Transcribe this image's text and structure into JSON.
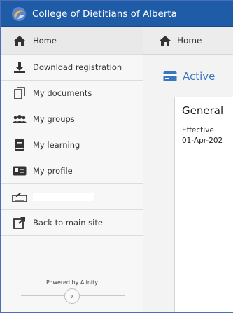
{
  "app": {
    "title": "College of Dietitians of Alberta",
    "brand_color": "#1f5ca8",
    "accent_color": "#3a77c2"
  },
  "sidebar": {
    "items": [
      {
        "label": "Home",
        "icon": "home-icon"
      },
      {
        "label": "Download registration",
        "icon": "download-icon"
      },
      {
        "label": "My documents",
        "icon": "documents-icon"
      },
      {
        "label": "My groups",
        "icon": "groups-icon"
      },
      {
        "label": "My learning",
        "icon": "book-icon"
      },
      {
        "label": "My profile",
        "icon": "id-card-icon"
      },
      {
        "label": "",
        "icon": "signature-icon"
      },
      {
        "label": "Back to main site",
        "icon": "external-link-icon"
      }
    ],
    "powered_by": "Powered by Alinity",
    "collapse": "«"
  },
  "main": {
    "breadcrumb": "Home",
    "section_title": "Active",
    "card": {
      "title": "General",
      "label": "Effective",
      "value": "01-Apr-202"
    }
  }
}
